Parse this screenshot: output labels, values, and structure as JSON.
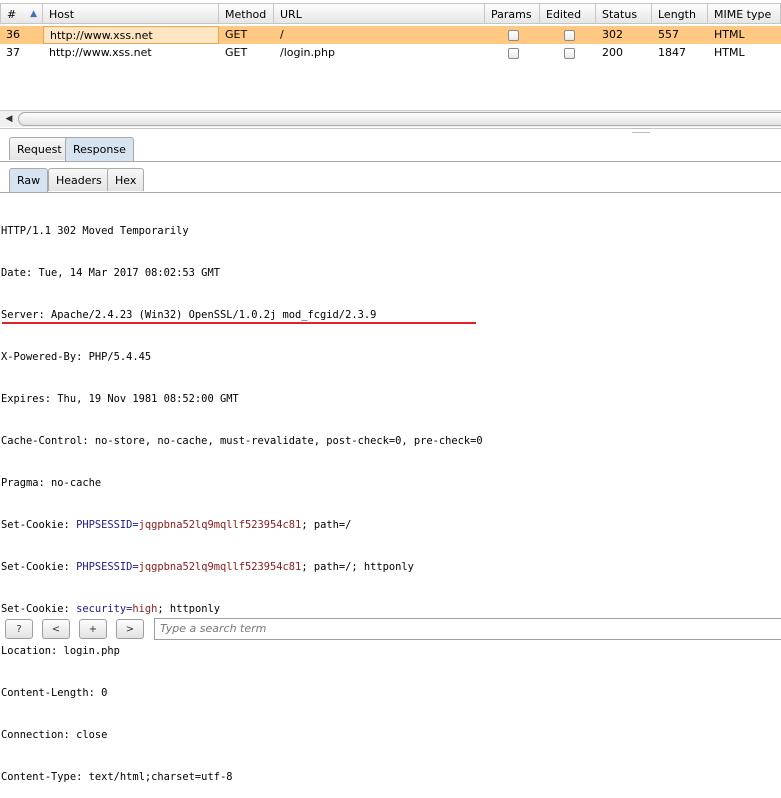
{
  "table": {
    "columns": [
      "#",
      "Host",
      "Method",
      "URL",
      "Params",
      "Edited",
      "Status",
      "Length",
      "MIME type"
    ],
    "rows": [
      {
        "num": "36",
        "host": "http://www.xss.net",
        "method": "GET",
        "url": "/",
        "params": false,
        "edited": false,
        "status": "302",
        "length": "557",
        "mime": "HTML",
        "selected": true
      },
      {
        "num": "37",
        "host": "http://www.xss.net",
        "method": "GET",
        "url": "/login.php",
        "params": false,
        "edited": false,
        "status": "200",
        "length": "1847",
        "mime": "HTML",
        "selected": false
      }
    ]
  },
  "tabs": {
    "message": [
      "Request",
      "Response"
    ],
    "message_active": "Response",
    "view": [
      "Raw",
      "Headers",
      "Hex"
    ],
    "view_active": "Raw"
  },
  "response": {
    "lines": [
      "HTTP/1.1 302 Moved Temporarily",
      "Date: Tue, 14 Mar 2017 08:02:53 GMT",
      "Server: Apache/2.4.23 (Win32) OpenSSL/1.0.2j mod_fcgid/2.3.9",
      "X-Powered-By: PHP/5.4.45",
      "Expires: Thu, 19 Nov 1981 08:52:00 GMT",
      "Cache-Control: no-store, no-cache, must-revalidate, post-check=0, pre-check=0",
      "Pragma: no-cache"
    ],
    "cookie_lines": [
      {
        "prefix": "Set-Cookie: ",
        "name": "PHPSESSID",
        "eq": "=",
        "value": "jqgpbna52lq9mqllf523954c81",
        "suffix": "; path=/"
      },
      {
        "prefix": "Set-Cookie: ",
        "name": "PHPSESSID",
        "eq": "=",
        "value": "jqgpbna52lq9mqllf523954c81",
        "suffix": "; path=/; httponly"
      },
      {
        "prefix": "Set-Cookie: ",
        "name": "security",
        "eq": "=",
        "value": "high",
        "suffix": "; httponly"
      }
    ],
    "trailing_lines": [
      "Location: login.php",
      "Content-Length: 0",
      "Connection: close",
      "Content-Type: text/html;charset=utf-8"
    ]
  },
  "bottom_bar": {
    "help": "?",
    "prev": "<",
    "add": "+",
    "next": ">",
    "search_placeholder": "Type a search term"
  },
  "colors": {
    "selected_row": "#ffc983",
    "cookie_name": "#1a1a8c",
    "cookie_value": "#8b1a1a",
    "highlight_underline": "#e0202a",
    "active_tab": "#d6e4f2"
  }
}
